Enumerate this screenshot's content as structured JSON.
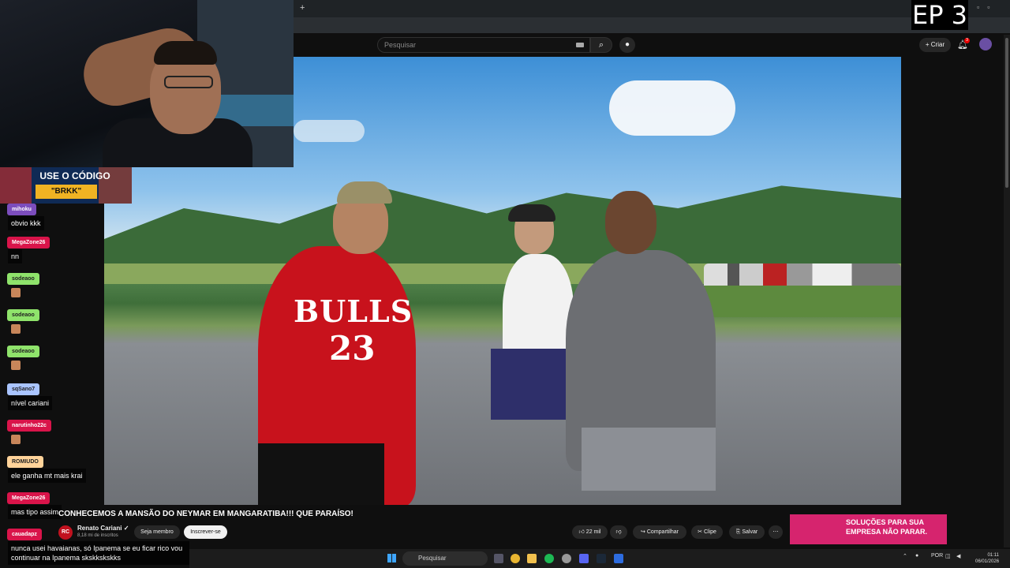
{
  "overlay": {
    "episode_label": "EP 3",
    "promo_line1": "USE O CÓDIGO",
    "promo_code": "\"BRKK\""
  },
  "youtube": {
    "search_placeholder": "Pesquisar",
    "create_label": "Criar",
    "notification_count": "3",
    "video_title": "CONHECEMOS A MANSÃO DO NEYMAR EM MANGARATIBA!!! QUE PARAÍSO!",
    "channel_name": "Renato Cariani",
    "channel_subs": "8,18 mi de inscritos",
    "member_label": "Seja membro",
    "subscribe_label": "Inscrever-se",
    "like_count": "22 mil",
    "share_label": "Compartilhar",
    "clip_label": "Clipe",
    "save_label": "Salvar",
    "ad_text": "SOLUÇÕES PARA SUA EMPRESA NÃO PARAR."
  },
  "video_frame": {
    "jersey_text": "BULLS",
    "jersey_number": "23"
  },
  "chat": [
    {
      "user": "mihoku",
      "text": "obvio kkk",
      "color": "#7c4dbd",
      "emoji": false
    },
    {
      "user": "MegaZone26",
      "text": "nn",
      "color": "#d9144a",
      "emoji": false
    },
    {
      "user": "sodeaoo",
      "text": "",
      "color": "#8fe36b",
      "emoji": true
    },
    {
      "user": "sodeaoo",
      "text": "",
      "color": "#8fe36b",
      "emoji": true
    },
    {
      "user": "sodeaoo",
      "text": "",
      "color": "#8fe36b",
      "emoji": true
    },
    {
      "user": "sqSano7",
      "text": "nível cariani",
      "color": "#a9c4ff",
      "emoji": false
    },
    {
      "user": "narutinho22c",
      "text": "",
      "color": "#d9144a",
      "emoji": true
    },
    {
      "user": "ROMIUDO",
      "text": "ele ganha mt mais krai",
      "color": "#ffd39a",
      "emoji": false
    },
    {
      "user": "MegaZone26",
      "text": "mas tipo assim",
      "color": "#d9144a",
      "emoji": false
    },
    {
      "user": "cauadapz",
      "text": "",
      "color": "#d9144a",
      "emoji": false
    }
  ],
  "last_message": "nunca usei havaianas, só Ipanema se eu ficar rico vou continuar na Ipanema skskkskskks",
  "taskbar": {
    "search_placeholder": "Pesquisar",
    "language": "POR",
    "time": "01:11",
    "date": "06/01/2026"
  }
}
